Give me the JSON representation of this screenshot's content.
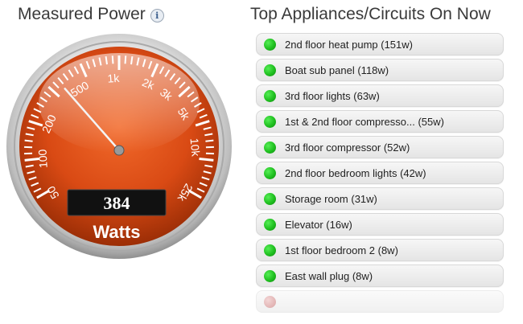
{
  "left_panel": {
    "title": "Measured Power",
    "info_icon": "info-icon"
  },
  "gauge": {
    "value": "384",
    "unit": "Watts",
    "needle_value": 384,
    "tick_labels": [
      "50",
      "100",
      "200",
      "500",
      "1k",
      "2k",
      "3k",
      "5k",
      "10k",
      "25k"
    ],
    "colors": {
      "face": "#d94a14",
      "rim": "#c9c9c9"
    }
  },
  "right_panel": {
    "title": "Top Appliances/Circuits On Now",
    "items": [
      {
        "label": "2nd floor heat pump (151w)"
      },
      {
        "label": "Boat sub panel (118w)"
      },
      {
        "label": "3rd floor lights (63w)"
      },
      {
        "label": "1st & 2nd floor compresso... (55w)"
      },
      {
        "label": "3rd floor compressor (52w)"
      },
      {
        "label": "2nd floor bedroom lights (42w)"
      },
      {
        "label": "Storage room (31w)"
      },
      {
        "label": "Elevator (16w)"
      },
      {
        "label": "1st floor bedroom 2 (8w)"
      },
      {
        "label": "East wall plug (8w)"
      },
      {
        "label": ""
      }
    ],
    "status_colors": {
      "on": "#22c022",
      "off": "#e2b4b4"
    }
  }
}
